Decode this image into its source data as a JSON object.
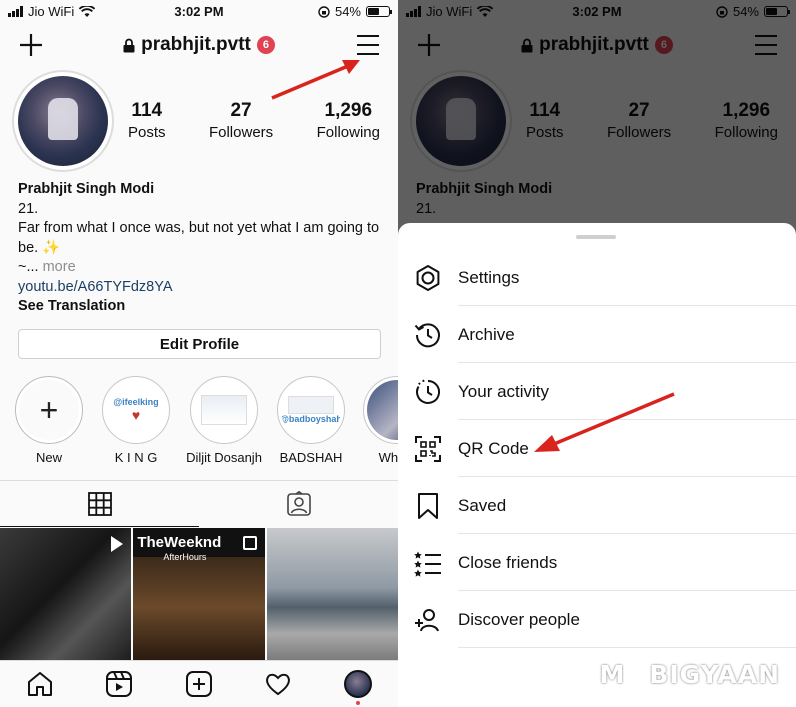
{
  "status_bar": {
    "carrier": "Jio WiFi",
    "time": "3:02 PM",
    "battery": "54%"
  },
  "profile": {
    "username": "prabhjit.pvtt",
    "notification_count": "6",
    "stats": [
      {
        "value": "114",
        "label": "Posts"
      },
      {
        "value": "27",
        "label": "Followers"
      },
      {
        "value": "1,296",
        "label": "Following"
      }
    ],
    "name": "Prabhjit Singh Modi",
    "bio_line1": "21.",
    "bio_line2": "Far from what I once was, but not yet what I am going to be. ✨",
    "bio_line3": "~...",
    "more": "more",
    "link": "youtu.be/A66TYFdz8YA",
    "see_translation": "See Translation",
    "edit_profile": "Edit Profile"
  },
  "highlights": [
    {
      "label": "New"
    },
    {
      "label": "K I N G"
    },
    {
      "label": "Diljit Dosanjh"
    },
    {
      "label": "BADSHAH"
    },
    {
      "label": "Whole"
    }
  ],
  "highlight_thumbs": {
    "king_tag": "@ifeelking",
    "badshah_tag": "@badboyshah"
  },
  "posts": {
    "post2_title": "TheWeeknd",
    "post2_subtitle": "AfterHours"
  },
  "menu": {
    "items": [
      {
        "label": "Settings",
        "icon": "settings-icon"
      },
      {
        "label": "Archive",
        "icon": "archive-icon"
      },
      {
        "label": "Your activity",
        "icon": "activity-icon"
      },
      {
        "label": "QR Code",
        "icon": "qr-code-icon"
      },
      {
        "label": "Saved",
        "icon": "bookmark-icon"
      },
      {
        "label": "Close friends",
        "icon": "close-friends-icon"
      },
      {
        "label": "Discover people",
        "icon": "add-person-icon"
      }
    ]
  },
  "watermark": {
    "prefix": "M",
    "suffix": "BIGYAAN"
  },
  "colors": {
    "badge": "#e04352",
    "link": "#1c3f66",
    "annotation_arrow": "#d9231d"
  }
}
